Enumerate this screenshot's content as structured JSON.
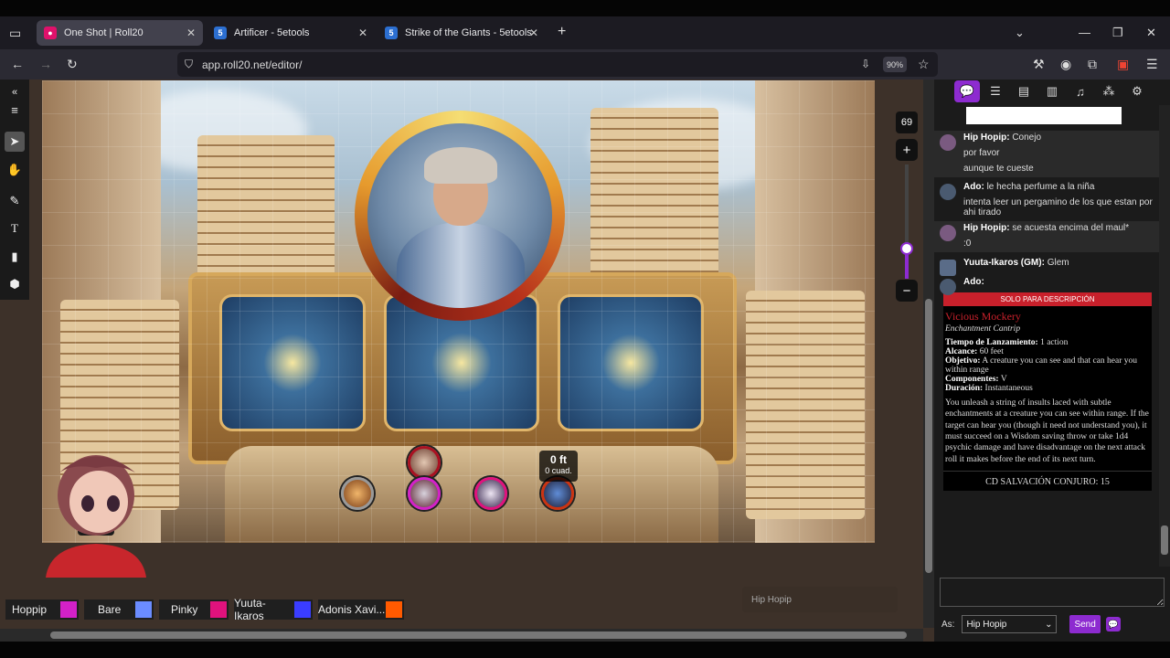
{
  "browser": {
    "tabs": [
      {
        "label": "One Shot | Roll20",
        "favicon": "roll20-icon",
        "active": true
      },
      {
        "label": "Artificer - 5etools",
        "favicon": "5etools-icon",
        "active": false
      },
      {
        "label": "Strike of the Giants - 5etools",
        "favicon": "5etools-icon",
        "active": false
      }
    ],
    "url": "app.roll20.net/editor/",
    "zoom": "90%"
  },
  "map": {
    "zoom_value": "69",
    "measure_distance": "0 ft",
    "measure_squares": "0 cuad."
  },
  "players": [
    {
      "name": "Hoppip",
      "color": "#d321c8"
    },
    {
      "name": "Bare",
      "color": "#6b8cff"
    },
    {
      "name": "Pinky",
      "color": "#e0127d"
    },
    {
      "name": "Yuuta-Ikaros",
      "color": "#3a3dff"
    },
    {
      "name": "Adonis Xavi...",
      "color": "#ff5a00"
    }
  ],
  "typing_indicator": "Hip Hopip",
  "chat": {
    "messages": [
      {
        "who": "Hip Hopip:",
        "lines": [
          "Conejo",
          "por favor",
          "aunque te cueste"
        ]
      },
      {
        "who": "Ado:",
        "lines": [
          "le hecha perfume a la niña",
          "intenta leer un pergamino de los que estan por ahi tirado"
        ]
      },
      {
        "who": "Hip Hopip:",
        "lines": [
          "se acuesta encima del maul*",
          ":0"
        ]
      },
      {
        "who": "Yuuta-Ikaros (GM):",
        "lines": [
          "Glem"
        ]
      },
      {
        "who": "Ado:",
        "lines": []
      }
    ],
    "spell": {
      "header": "SOLO PARA DESCRIPCIÓN",
      "name": "Vicious Mockery",
      "school": "Enchantment Cantrip",
      "casting_time_label": "Tiempo de Lanzamiento:",
      "casting_time": "1 action",
      "range_label": "Alcance:",
      "range": "60 feet",
      "target_label": "Objetivo:",
      "target": "A creature you can see and that can hear you within range",
      "components_label": "Componentes:",
      "components": "V",
      "duration_label": "Duración:",
      "duration": "Instantaneous",
      "description": "You unleash a string of insults laced with subtle enchantments at a creature you can see within range. If the target can hear you (though it need not understand you), it must succeed on a Wisdom saving throw or take 1d4 psychic damage and have disadvantage on the next attack roll it makes before the end of its next turn.",
      "save_dc": "CD SALVACIÓN CONJURO: 15"
    },
    "as_label": "As:",
    "as_value": "Hip Hopip",
    "send_label": "Send"
  },
  "colors": {
    "accent": "#8d2bd0",
    "spell_red": "#c8202b"
  }
}
